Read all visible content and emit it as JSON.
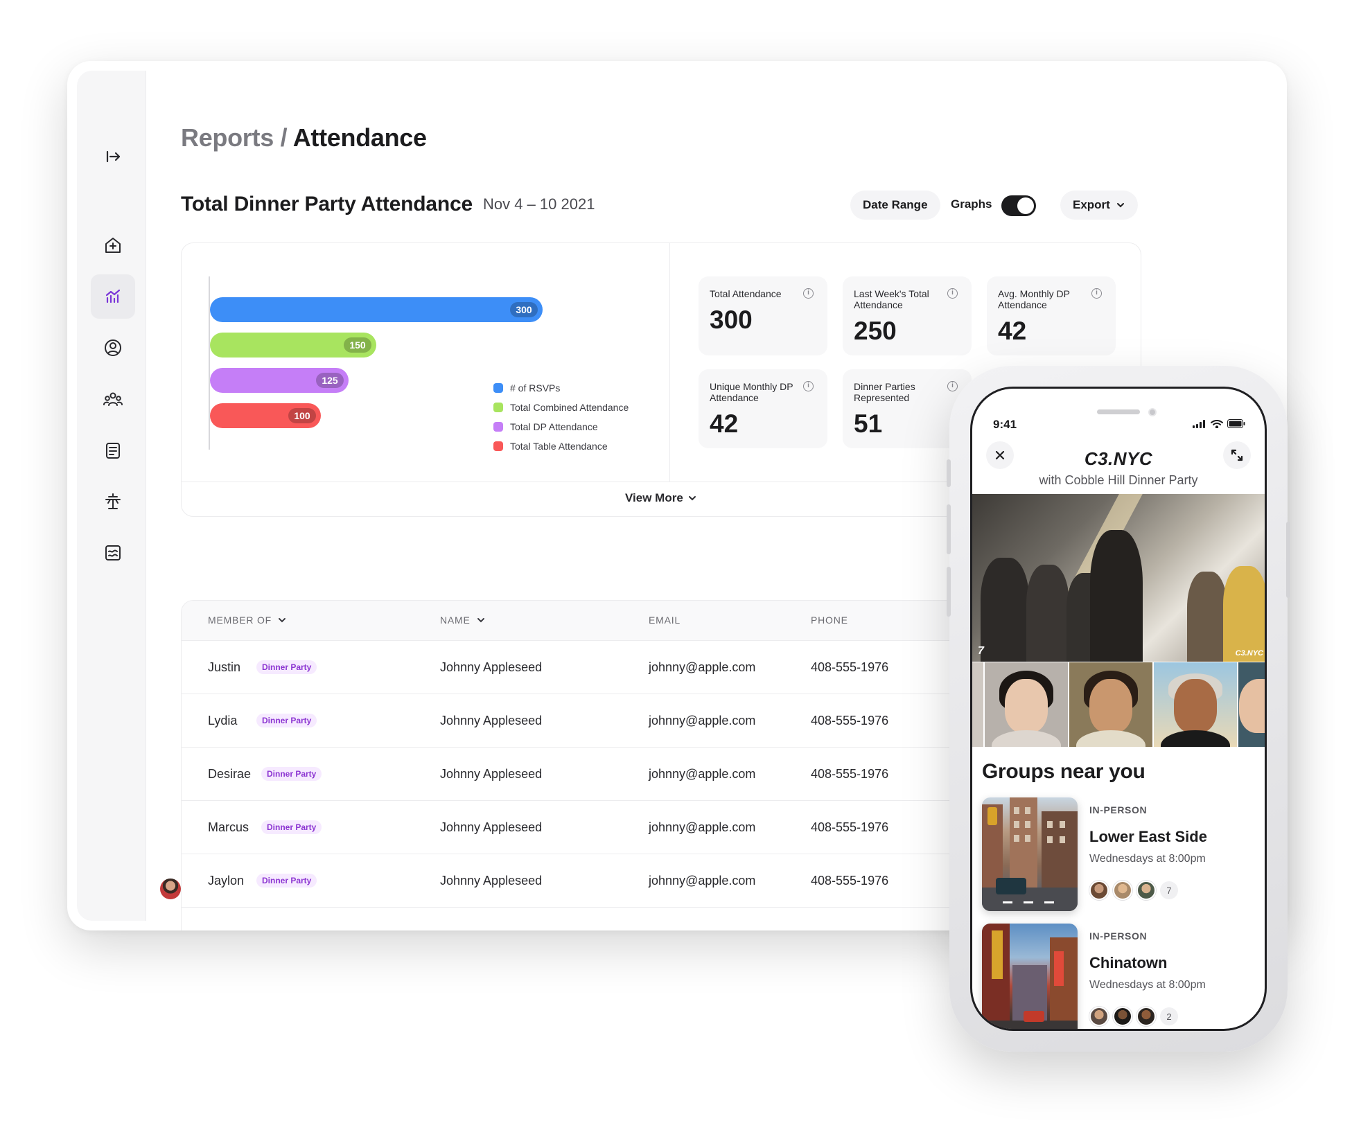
{
  "breadcrumb": {
    "parent": "Reports",
    "separator": "/",
    "current": "Attendance"
  },
  "section": {
    "title": "Total Dinner Party Attendance",
    "date": "Nov 4 – 10 2021"
  },
  "toolbar": {
    "date_range_label": "Date Range",
    "graphs_label": "Graphs",
    "graphs_on": true,
    "export_label": "Export"
  },
  "sidebar": {
    "items": [
      {
        "icon": "collapse-arrow-icon"
      },
      {
        "icon": "home-plus-icon"
      },
      {
        "icon": "chart-icon",
        "active": true
      },
      {
        "icon": "user-circle-icon"
      },
      {
        "icon": "group-icon"
      },
      {
        "icon": "document-list-icon"
      },
      {
        "icon": "table-icon"
      },
      {
        "icon": "report-icon"
      }
    ]
  },
  "chart_data": {
    "type": "bar",
    "orientation": "horizontal",
    "categories": [
      "# of RSVPs",
      "Total Combined Attendance",
      "Total DP Attendance",
      "Total Table Attendance"
    ],
    "values": [
      300,
      150,
      125,
      100
    ],
    "colors": [
      "#3d8ef7",
      "#a8e45f",
      "#c57ef7",
      "#f95858"
    ],
    "xlim": [
      0,
      300
    ],
    "legend_position": "right",
    "grid": false
  },
  "stats": [
    {
      "label": "Total Attendance",
      "value": "300"
    },
    {
      "label": "Last Week's Total Attendance",
      "value": "250"
    },
    {
      "label": "Avg. Monthly DP Attendance",
      "value": "42"
    },
    {
      "label": "Unique Monthly DP Attendance",
      "value": "42"
    },
    {
      "label": "Dinner Parties Represented",
      "value": "51"
    }
  ],
  "view_more_label": "View More",
  "table": {
    "headers": [
      "MEMBER OF",
      "NAME",
      "EMAIL",
      "PHONE"
    ],
    "rows": [
      {
        "member": "Justin",
        "badge": "Dinner Party",
        "name": "Johnny Appleseed",
        "email": "johnny@apple.com",
        "phone": "408-555-1976"
      },
      {
        "member": "Lydia",
        "badge": "Dinner Party",
        "name": "Johnny Appleseed",
        "email": "johnny@apple.com",
        "phone": "408-555-1976"
      },
      {
        "member": "Desirae",
        "badge": "Dinner Party",
        "name": "Johnny Appleseed",
        "email": "johnny@apple.com",
        "phone": "408-555-1976"
      },
      {
        "member": "Marcus",
        "badge": "Dinner Party",
        "name": "Johnny Appleseed",
        "email": "johnny@apple.com",
        "phone": "408-555-1976"
      },
      {
        "member": "Jaylon",
        "badge": "Dinner Party",
        "name": "Johnny Appleseed",
        "email": "johnny@apple.com",
        "phone": "408-555-1976"
      }
    ]
  },
  "phone": {
    "time": "9:41",
    "title": "C3.NYC",
    "subtitle": "with Cobble Hill Dinner Party",
    "video_badge": "7",
    "video_logo": "C3.NYC",
    "groups_title": "Groups near you",
    "groups": [
      {
        "kind": "IN-PERSON",
        "name": "Lower East Side",
        "when": "Wednesdays at 8:00pm",
        "count": "7"
      },
      {
        "kind": "IN-PERSON",
        "name": "Chinatown",
        "when": "Wednesdays at 8:00pm",
        "count": "2"
      }
    ]
  }
}
